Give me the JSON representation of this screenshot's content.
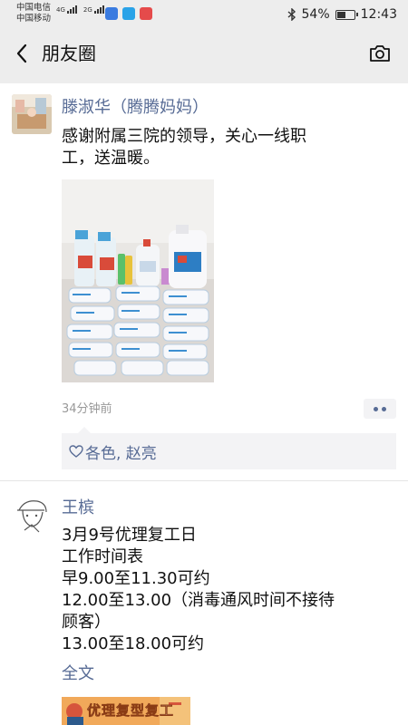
{
  "status_bar": {
    "carrier_1": "中国电信",
    "carrier_2": "中国移动",
    "network_1": "4G",
    "network_2": "2G",
    "battery_percent": 54,
    "battery_text": "54%",
    "time": "12:43"
  },
  "navbar": {
    "title": "朋友圈"
  },
  "posts": [
    {
      "author": "滕淑华（腾腾妈妈）",
      "text": "感谢附属三院的领导，关心一线职\n工，送温暖。",
      "time": "34分钟前",
      "likes": "各色, 赵亮"
    },
    {
      "author": "王槟",
      "text": "3月9号优理复工日\n工作时间表\n早9.00至11.30可约\n12.00至13.00（消毒通风时间不接待\n顾客）\n13.00至18.00可约",
      "full_text_link": "全文",
      "poster_text": "优理复型复工"
    }
  ],
  "colors": {
    "link_blue": "#576b95",
    "background": "#ededed"
  }
}
